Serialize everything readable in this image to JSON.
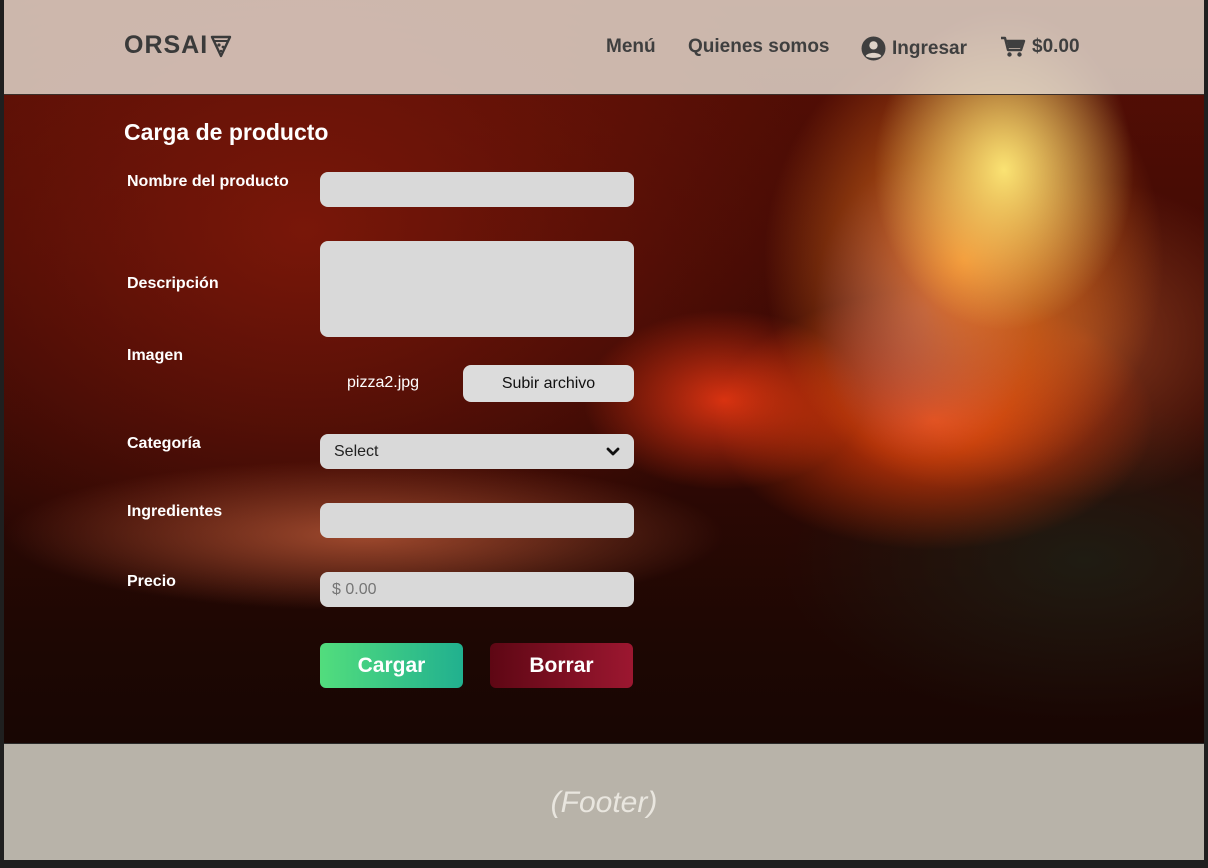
{
  "header": {
    "logo": "ORSAI",
    "nav": {
      "menu": "Menú",
      "about": "Quienes somos",
      "login": "Ingresar",
      "cart_total": "$0.00"
    }
  },
  "form": {
    "title": "Carga de producto",
    "labels": {
      "name": "Nombre del producto",
      "description": "Descripción",
      "image": "Imagen",
      "category": "Categoría",
      "ingredients": "Ingredientes",
      "price": "Precio"
    },
    "values": {
      "name": "",
      "description": "",
      "ingredients": ""
    },
    "image_file": "pizza2.jpg",
    "upload_label": "Subir archivo",
    "category_selected": "Select",
    "price_placeholder": "$ 0.00",
    "submit_label": "Cargar",
    "reset_label": "Borrar"
  },
  "footer": {
    "text": "(Footer)"
  },
  "colors": {
    "submit_gradient": [
      "#52dd7d",
      "#21b08f"
    ],
    "reset_gradient": [
      "#5e0714",
      "#9c1730"
    ]
  },
  "icons": {
    "logo": "pizza-slice-icon",
    "login": "user-circle-icon",
    "cart": "shopping-cart-icon",
    "select": "chevron-down-icon"
  }
}
